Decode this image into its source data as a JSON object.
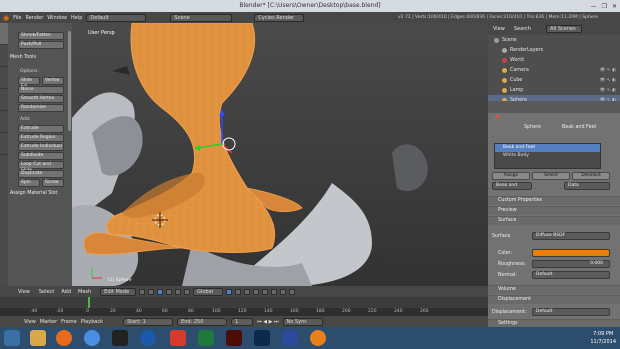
{
  "window": {
    "title": "Blender* [C:\\Users\\Owner\\Desktop\\base.blend]",
    "controls": [
      "—",
      "❐",
      "✕"
    ]
  },
  "infobar": {
    "menus": [
      "File",
      "Render",
      "Window",
      "Help"
    ],
    "layout": "Default",
    "scene": "Scene",
    "engine": "Cycles Render",
    "stats": "v2.72 | Verts:100/410 | Edges:400/836 | Faces:216/410 | Tris:836 | Mem:11.20M | Sphere"
  },
  "toolshelf": {
    "tabs": [
      "Tools",
      "Create",
      "Relations",
      "Display",
      "Shading/UVs",
      "Grease Pencil"
    ],
    "top_buttons": [
      "Shrink/Fatten",
      "Push/Pull"
    ],
    "mesh_tools_header": "Mesh Tools",
    "deform_label": "Options:",
    "row_slide": [
      "Slide Ed",
      "Vertex"
    ],
    "noise": "Noise",
    "smooth": "Smooth Vertex",
    "randomize": "Randomize",
    "add_label": "Add:",
    "extrude": "Extrude",
    "extrude_region": "Extrude Region",
    "extrude_individual": "Extrude Individual",
    "subdivide": "Subdivide",
    "loop_cut": "Loop Cut and Slide",
    "duplicate": "Duplicate",
    "row_spin": [
      "Spin",
      "Screw"
    ],
    "assign_section": "Assign Material Slot"
  },
  "viewport": {
    "view_label": "User Persp",
    "object_label": "(1) Sphere",
    "header": {
      "menus": [
        "View",
        "Select",
        "Add",
        "Mesh"
      ],
      "mode": "Edit Mode",
      "orientation": "Global"
    }
  },
  "timeline": {
    "ruler": [
      "-40",
      "-20",
      "0",
      "20",
      "40",
      "60",
      "80",
      "100",
      "120",
      "140",
      "160",
      "180",
      "200",
      "220",
      "240",
      "260"
    ],
    "menus": [
      "View",
      "Marker",
      "Frame",
      "Playback"
    ],
    "start": "Start:",
    "start_val": "1",
    "end": "End:",
    "end_val": "250",
    "current": "1",
    "sync": "No Sync"
  },
  "outliner": {
    "header_menus": [
      "View",
      "Search",
      "All Scenes"
    ],
    "rows": [
      {
        "label": "Scene",
        "color": "#9a9a9a"
      },
      {
        "label": "RenderLayers",
        "color": "#aaaaaa"
      },
      {
        "label": "World",
        "color": "#cc4444"
      },
      {
        "label": "Camera",
        "color": "#ddaa44"
      },
      {
        "label": "Cube",
        "color": "#ddaa44"
      },
      {
        "label": "Lamp",
        "color": "#ddaa44"
      },
      {
        "label": "Sphere",
        "color": "#ddaa44"
      }
    ]
  },
  "properties": {
    "object": "Sphere",
    "material_name": "Beak and Feet",
    "slots": [
      "Beak and Feet",
      "White Body"
    ],
    "assign": "Assign",
    "select": "Select",
    "deselect": "Deselect",
    "mat_field": "Beak and",
    "data_dd": "Data",
    "custom_props": "Custom Properties",
    "preview": "Preview",
    "surface_section": "Surface",
    "surface_label": "Surface",
    "surface_value": "Diffuse BSDF",
    "color_label": "Color:",
    "color_value": "#f07c00",
    "roughness_label": "Roughness:",
    "roughness_value": "0.000",
    "normal_label": "Normal:",
    "normal_value": "Default",
    "volume": "Volume",
    "displacement_section": "Displacement",
    "displacement_label": "Displacement:",
    "displacement_value": "Default",
    "settings": "Settings"
  },
  "taskbar": {
    "time": "7:09 PM",
    "date": "11/7/2014"
  }
}
